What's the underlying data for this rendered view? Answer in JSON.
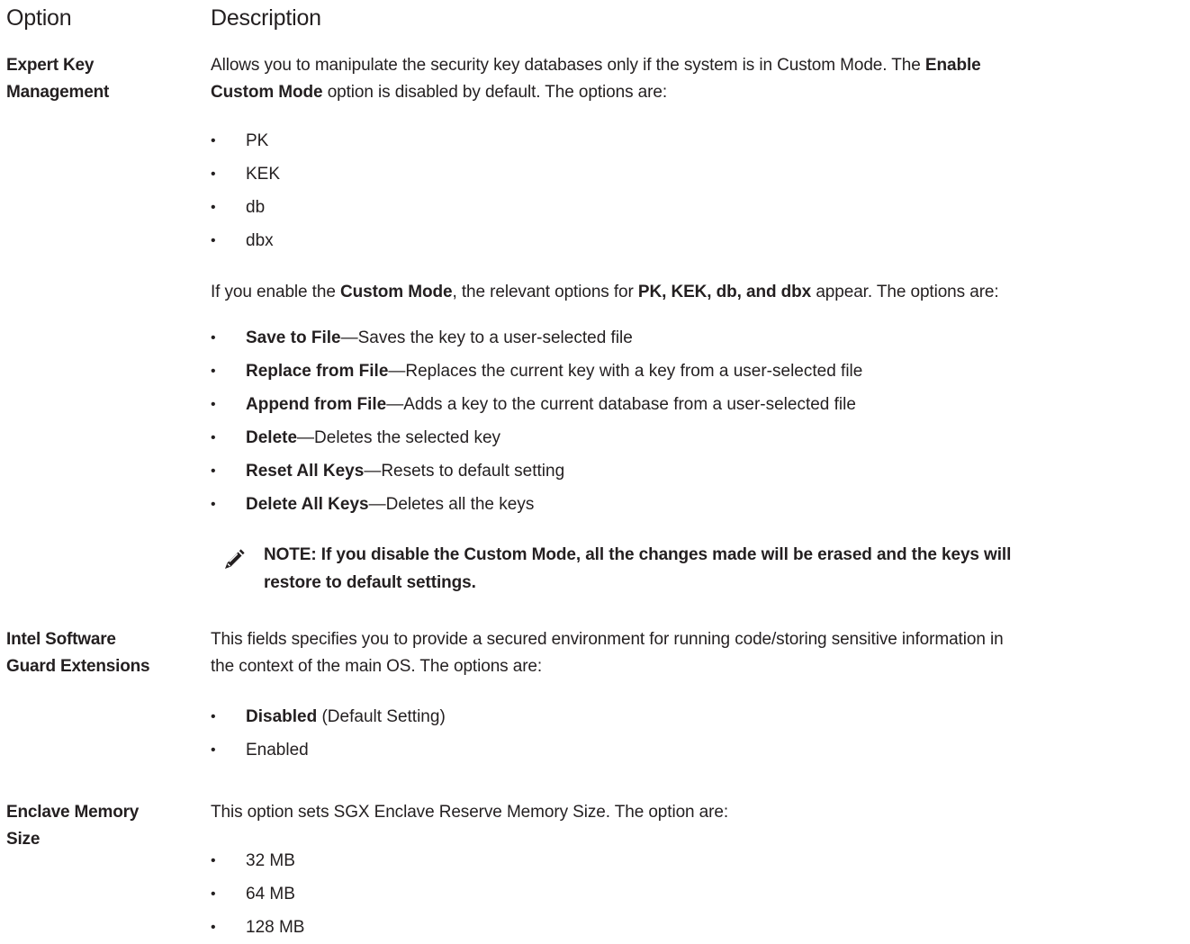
{
  "header": {
    "option": "Option",
    "description": "Description"
  },
  "expert_key": {
    "term_line1": "Expert Key",
    "term_line2": "Management",
    "desc1_a": "Allows you to manipulate the security key databases only if the system is in Custom Mode. The ",
    "desc1_b": "Enable",
    "desc1_c": "Custom Mode",
    "desc1_d": " option is disabled by default. The options are:",
    "keys": [
      "PK",
      "KEK",
      "db",
      "dbx"
    ],
    "desc2_a": "If you enable the ",
    "desc2_b": "Custom Mode",
    "desc2_c": ", the relevant options for ",
    "desc2_d": "PK, KEK, db, and dbx",
    "desc2_e": " appear. The options are:",
    "actions": [
      {
        "name": "Save to File",
        "text": "—Saves the key to a user-selected file"
      },
      {
        "name": "Replace from File",
        "text": "—Replaces the current key with a key from a user-selected file"
      },
      {
        "name": "Append from File",
        "text": "—Adds a key to the current database from a user-selected file"
      },
      {
        "name": "Delete",
        "text": "—Deletes the selected key"
      },
      {
        "name": "Reset All Keys",
        "text": "—Resets to default setting"
      },
      {
        "name": "Delete All Keys",
        "text": "—Deletes all the keys"
      }
    ],
    "note_line1": "NOTE: If you disable the Custom Mode, all the changes made will be erased and the keys will",
    "note_line2": "restore to default settings."
  },
  "sgx": {
    "term_line1": "Intel Software",
    "term_line2": "Guard Extensions",
    "desc_line1": "This fields specifies you to provide a secured environment for running code/storing sensitive information in",
    "desc_line2": "the context of the main OS. The options are:",
    "opt1_name": "Disabled",
    "opt1_text": " (Default Setting)",
    "opt2": "Enabled"
  },
  "enclave": {
    "term_line1": "Enclave Memory",
    "term_line2": "Size",
    "desc": "This option sets SGX Enclave Reserve Memory Size. The option are:",
    "sizes": [
      "32 MB",
      "64 MB",
      "128 MB"
    ]
  },
  "icons": {
    "bullet": "•",
    "note_icon": "pencil-icon",
    "ink": "#231f20"
  }
}
